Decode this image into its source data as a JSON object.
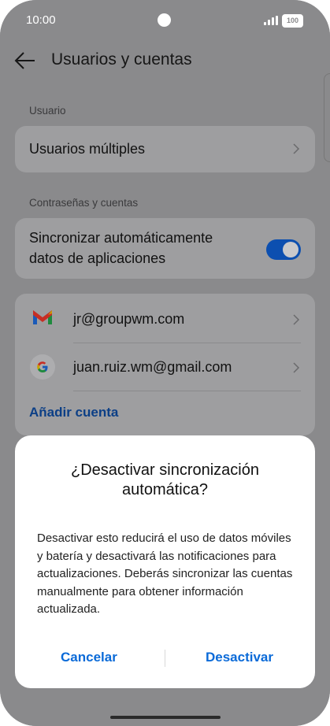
{
  "status_bar": {
    "time": "10:00",
    "battery": "100"
  },
  "header": {
    "title": "Usuarios y cuentas"
  },
  "section_user": {
    "label": "Usuario",
    "item": "Usuarios múltiples"
  },
  "section_accounts": {
    "label": "Contraseñas y cuentas",
    "sync_line1": "Sincronizar automáticamente",
    "sync_line2": "datos de aplicaciones",
    "sync_enabled": true
  },
  "accounts": [
    {
      "icon": "gmail-icon",
      "email": "jr@groupwm.com"
    },
    {
      "icon": "google-icon",
      "email": "juan.ruiz.wm@gmail.com"
    }
  ],
  "add_account": "Añadir cuenta",
  "dialog": {
    "title_line1": "¿Desactivar sincronización",
    "title_line2": "automática?",
    "body": "Desactivar esto reducirá el uso de datos móviles y batería y desactivará las notificaciones para actualizaciones. Deberás sincronizar las cuentas manualmente para obtener información actualizada.",
    "cancel": "Cancelar",
    "confirm": "Desactivar"
  },
  "colors": {
    "accent": "#0a6ad8",
    "scrim_bg": "#8a8a8c",
    "toggle_on": "#0c4fb0"
  }
}
